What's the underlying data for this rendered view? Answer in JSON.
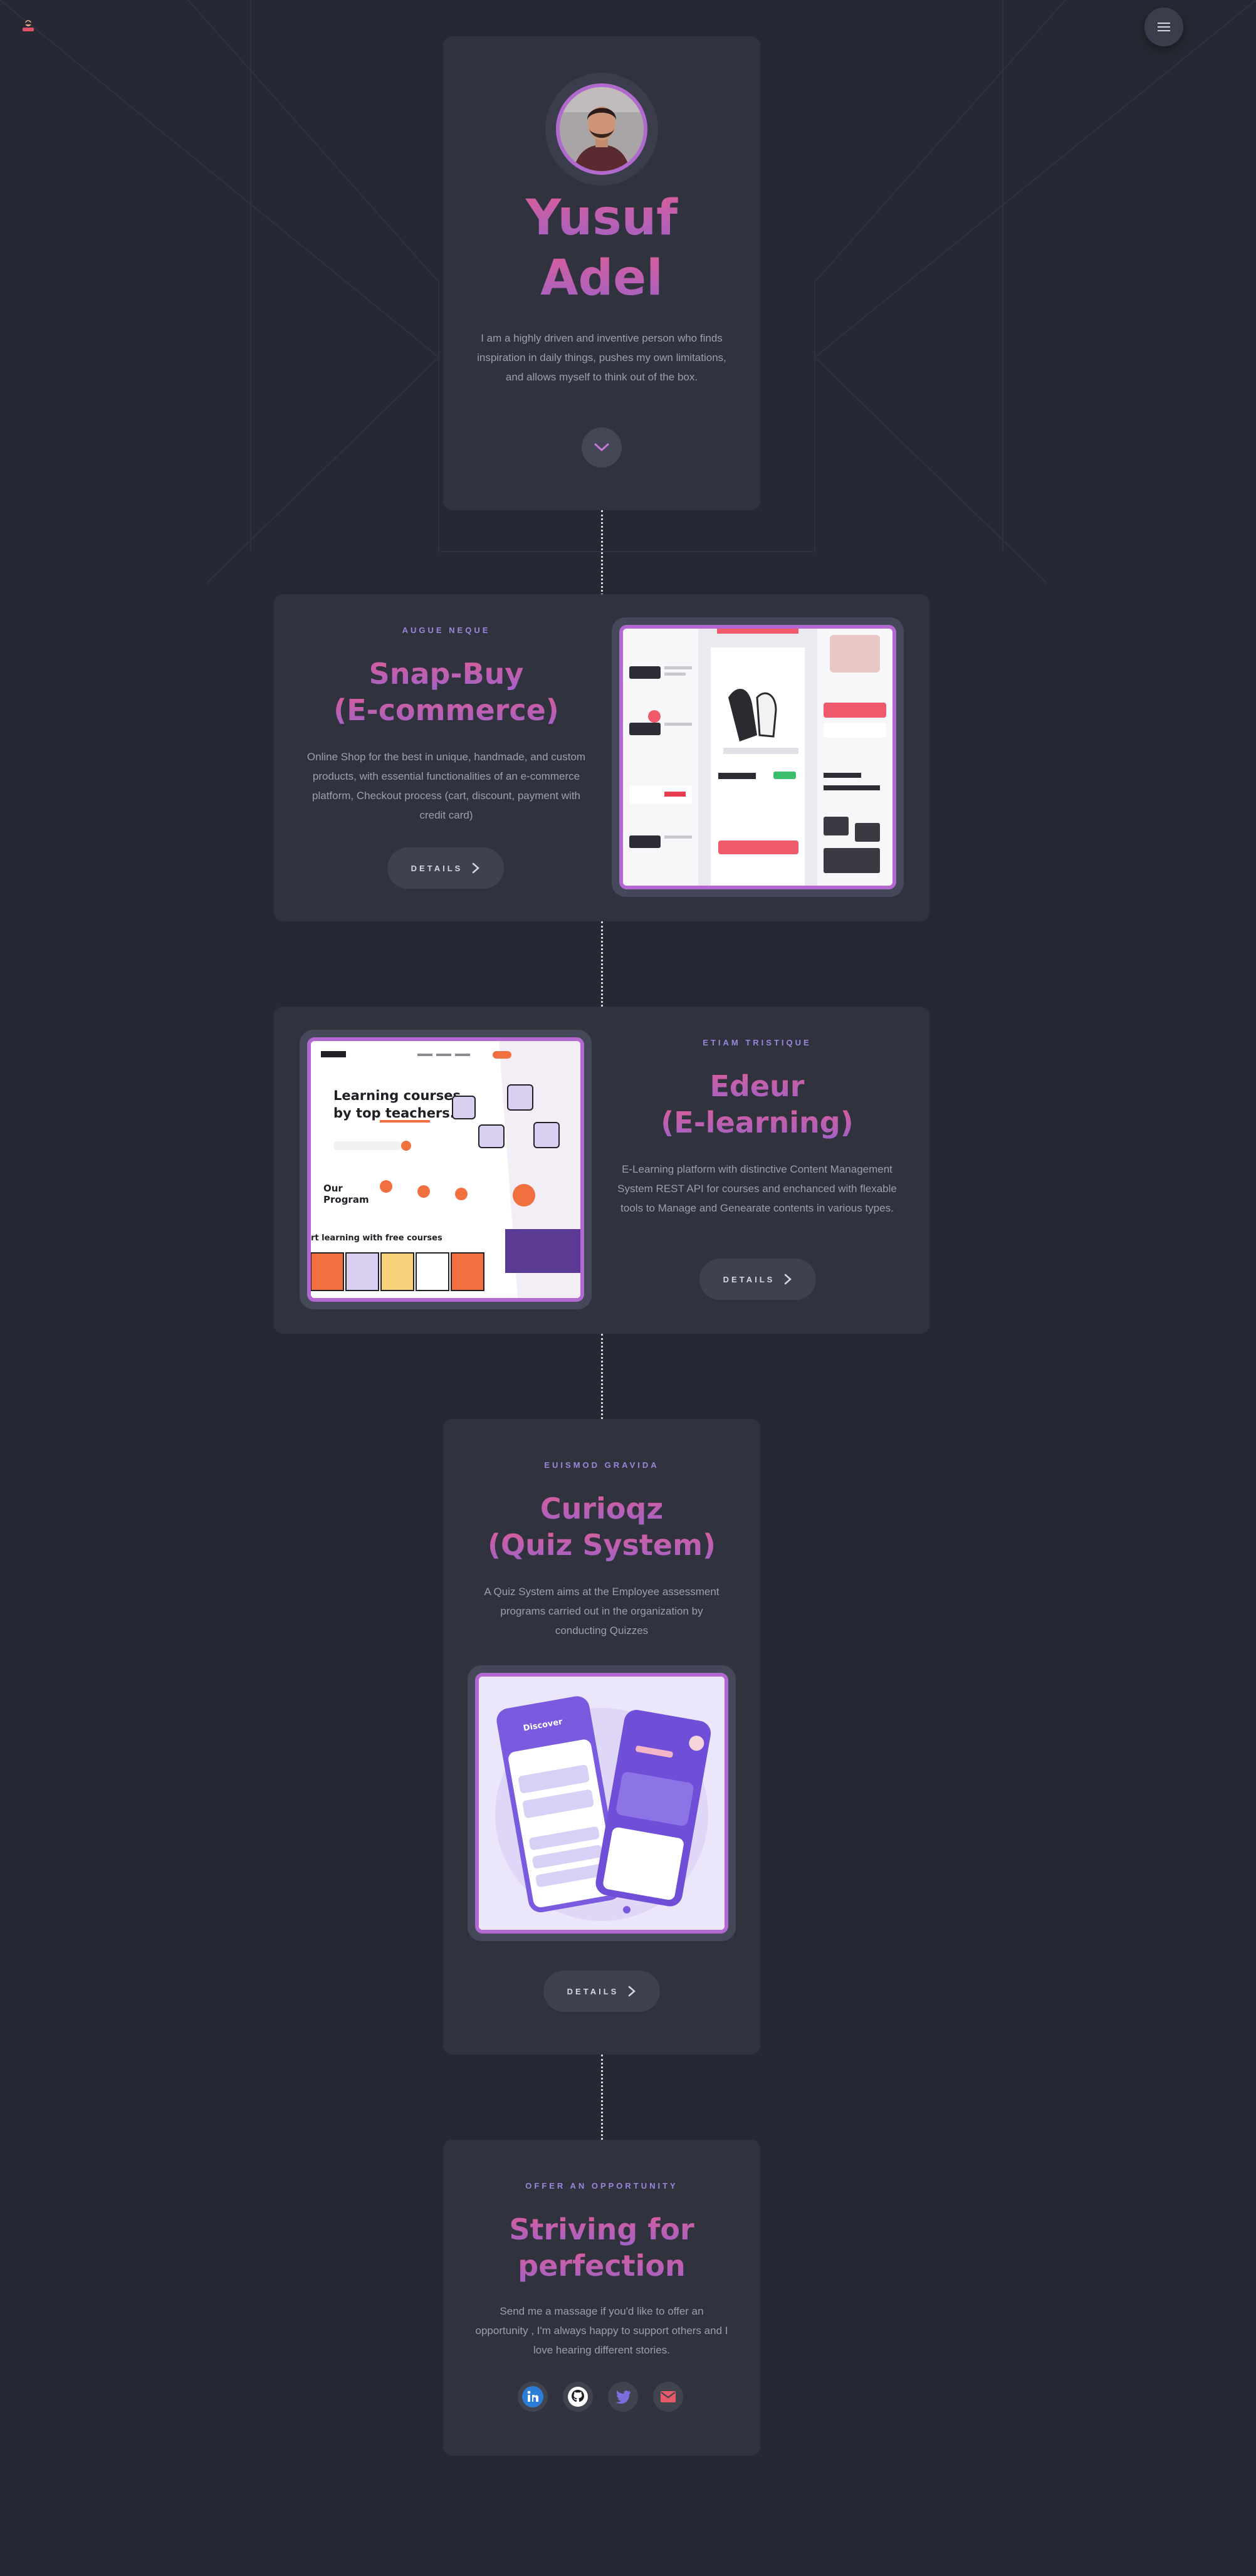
{
  "hero": {
    "first_name": "Yusuf",
    "last_name": "Adel",
    "bio": "I am a highly driven and inventive person who finds inspiration in daily things, pushes my own limitations, and allows myself to think out of the box."
  },
  "projects": [
    {
      "eyebrow": "AUGUE NEQUE",
      "title_line1": "Snap-Buy",
      "title_line2": "(E-commerce)",
      "description": "Online Shop for the best in unique, handmade, and custom products, with essential functionalities of an e-commerce platform, Checkout process (cart, discount, payment with credit card)",
      "button_label": "DETAILS"
    },
    {
      "eyebrow": "ETIAM TRISTIQUE",
      "title_line1": "Edeur",
      "title_line2": "(E-learning)",
      "description": "E-Learning platform with distinctive Content Management System REST API for courses and enchanced with flexable tools to Manage and Genearate contents in various types.",
      "button_label": "DETAILS",
      "shot_heading": "Learning courses by top teachers.",
      "shot_section": "Our Program",
      "shot_footer": "Start learning with free courses"
    },
    {
      "eyebrow": "EUISMOD GRAVIDA",
      "title_line1": "Curioqz",
      "title_line2": "(Quiz System)",
      "description": "A Quiz System aims at the Employee assessment programs carried out in the organization by conducting Quizzes",
      "button_label": "DETAILS",
      "shot_phone_title": "Discover"
    }
  ],
  "contact": {
    "eyebrow": "OFFER AN OPPORTUNITY",
    "title_line1": "Striving for",
    "title_line2": "perfection",
    "description": "Send me a massage if you'd like to offer an opportunity , I'm always happy to support others and I love hearing different stories."
  },
  "socials": [
    {
      "icon": "linkedin-icon",
      "color": "#2a7ed8"
    },
    {
      "icon": "github-icon",
      "color": "#ffffff"
    },
    {
      "icon": "twitter-icon",
      "color": "#7b6fe0"
    },
    {
      "icon": "email-icon",
      "color": "#e55b6a"
    }
  ],
  "theme": {
    "background": "#262833",
    "card": "#30323e",
    "accent_pink": "#dd5d97",
    "accent_purple": "#9e62c9",
    "eyebrow": "#9a87dc"
  }
}
